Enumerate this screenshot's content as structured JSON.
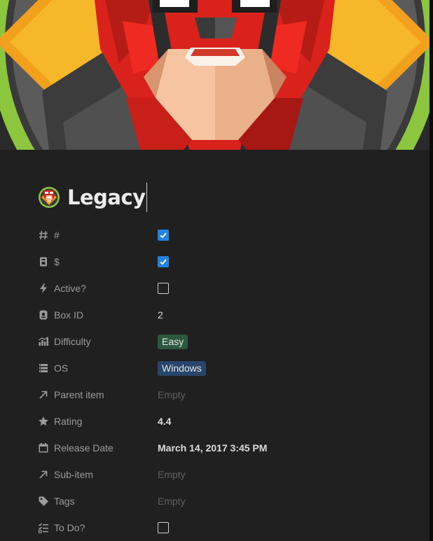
{
  "page": {
    "title": "Legacy",
    "icon": "htb-avatar-icon"
  },
  "properties": [
    {
      "key": "hash",
      "icon": "hash-icon",
      "label": "#",
      "type": "checkbox",
      "checked": true
    },
    {
      "key": "dollar",
      "icon": "dollar-badge-icon",
      "label": "$",
      "type": "checkbox",
      "checked": true
    },
    {
      "key": "active",
      "icon": "lightning-icon",
      "label": "Active?",
      "type": "checkbox",
      "checked": false
    },
    {
      "key": "box_id",
      "icon": "id-badge-icon",
      "label": "Box ID",
      "type": "text",
      "value": "2"
    },
    {
      "key": "difficulty",
      "icon": "bar-chart-icon",
      "label": "Difficulty",
      "type": "tag",
      "value": "Easy",
      "color": "#2b593f"
    },
    {
      "key": "os",
      "icon": "list-icon",
      "label": "OS",
      "type": "tag",
      "value": "Windows",
      "color": "#28456c"
    },
    {
      "key": "parent_item",
      "icon": "arrow-up-right-icon",
      "label": "Parent item",
      "type": "empty",
      "value": "Empty"
    },
    {
      "key": "rating",
      "icon": "star-icon",
      "label": "Rating",
      "type": "text",
      "value": "4.4"
    },
    {
      "key": "release_date",
      "icon": "calendar-icon",
      "label": "Release Date",
      "type": "text",
      "value": "March 14, 2017 3:45 PM"
    },
    {
      "key": "sub_item",
      "icon": "arrow-up-right-icon",
      "label": "Sub-item",
      "type": "empty",
      "value": "Empty"
    },
    {
      "key": "tags",
      "icon": "tag-icon",
      "label": "Tags",
      "type": "empty",
      "value": "Empty"
    },
    {
      "key": "todo",
      "icon": "checklist-icon",
      "label": "To Do?",
      "type": "checkbox",
      "checked": false
    }
  ],
  "colors": {
    "background": "#202020",
    "checkbox_accent": "#2383e2",
    "tag_green": "#2b593f",
    "tag_blue": "#28456c"
  }
}
